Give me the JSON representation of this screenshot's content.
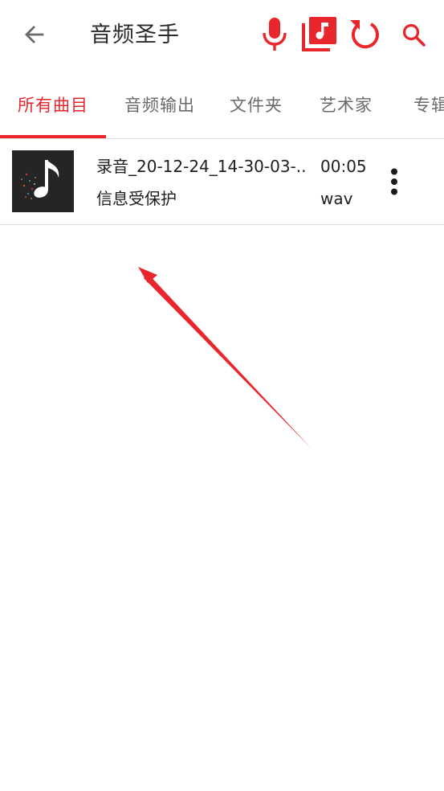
{
  "app": {
    "title": "音频圣手",
    "accent_color": "#e8262b"
  },
  "toolbar": {
    "back_icon": "arrow-left-icon",
    "actions": [
      {
        "name": "record",
        "icon": "microphone-icon"
      },
      {
        "name": "library",
        "icon": "music-library-icon"
      },
      {
        "name": "refresh",
        "icon": "refresh-icon"
      },
      {
        "name": "search",
        "icon": "search-icon"
      }
    ]
  },
  "tabs": [
    {
      "label": "所有曲目",
      "active": true
    },
    {
      "label": "音频输出",
      "active": false
    },
    {
      "label": "文件夹",
      "active": false
    },
    {
      "label": "艺术家",
      "active": false
    },
    {
      "label": "专辑",
      "active": false
    }
  ],
  "tracks": [
    {
      "title": "录音_20-12-24_14-30-03-...",
      "subtitle": "信息受保护",
      "duration": "00:05",
      "format": "wav",
      "thumbnail_icon": "music-note-icon"
    }
  ],
  "annotation": {
    "type": "arrow",
    "color": "#e8262b"
  }
}
